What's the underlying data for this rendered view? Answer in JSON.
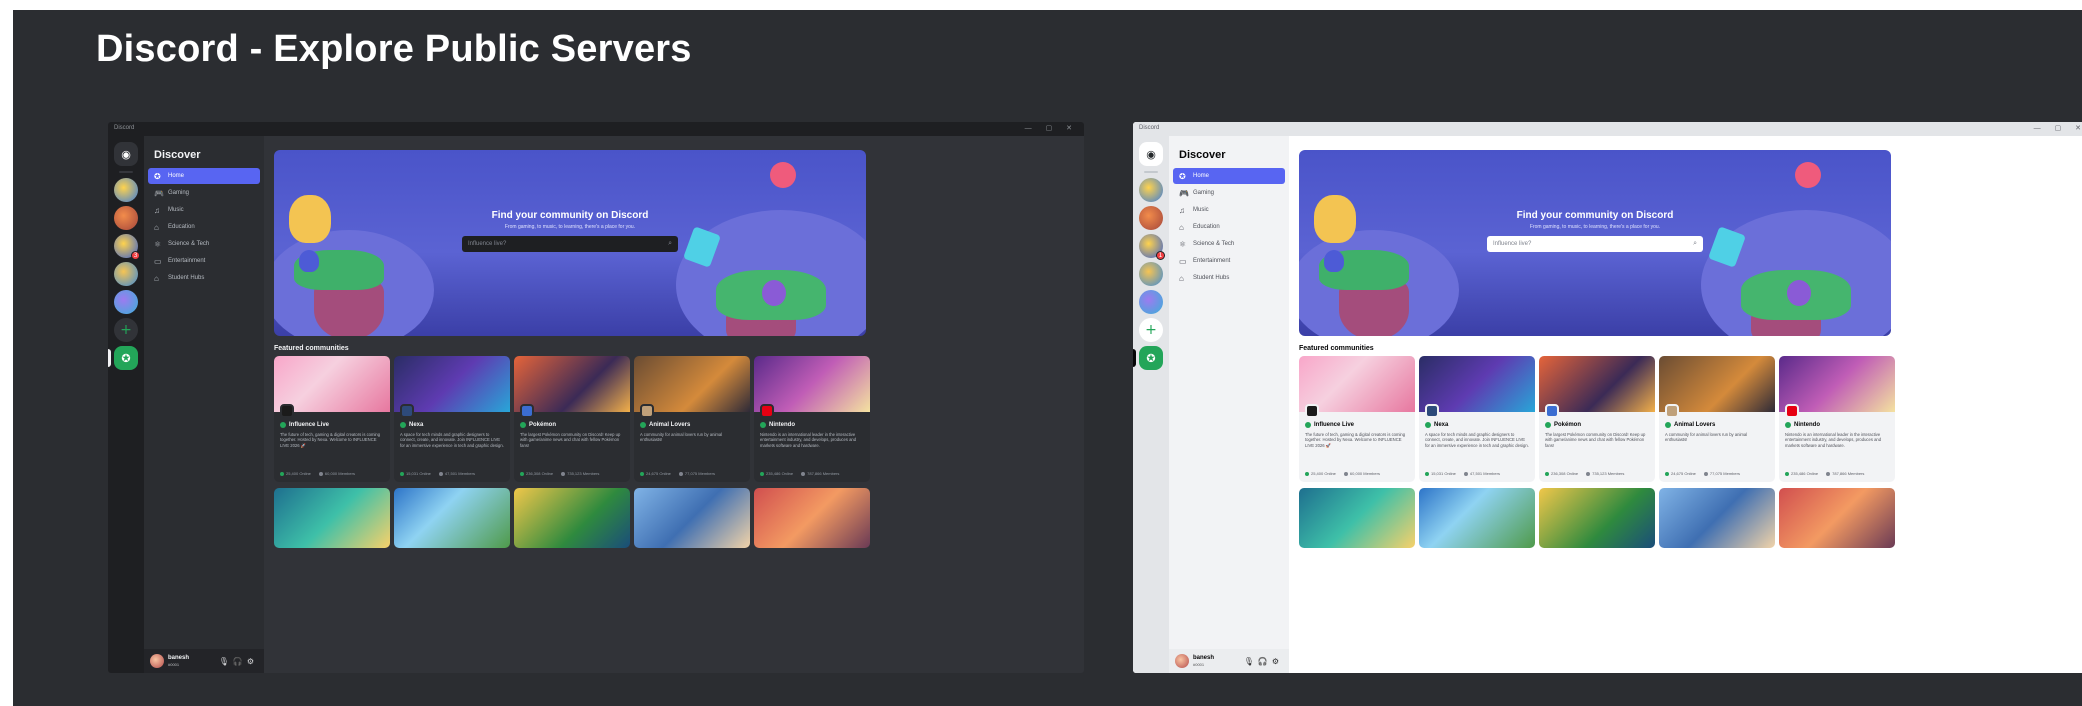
{
  "page_title": "Discord - Explore Public Servers",
  "window": {
    "title": "Discord",
    "controls": "— ▢ ✕"
  },
  "rail": {
    "badges": [
      "3",
      "1"
    ]
  },
  "sidebar": {
    "title": "Discover",
    "items": [
      {
        "label": "Home",
        "icon": "compass-icon"
      },
      {
        "label": "Gaming",
        "icon": "gamepad-icon"
      },
      {
        "label": "Music",
        "icon": "music-note-icon"
      },
      {
        "label": "Education",
        "icon": "graduation-cap-icon"
      },
      {
        "label": "Science & Tech",
        "icon": "atom-icon"
      },
      {
        "label": "Entertainment",
        "icon": "tv-icon"
      },
      {
        "label": "Student Hubs",
        "icon": "school-icon"
      }
    ]
  },
  "user": {
    "name": "banesh",
    "tag": "#0001"
  },
  "hero": {
    "title": "Find your community on Discord",
    "subtitle": "From gaming, to music, to learning, there's a place for you.",
    "search_placeholder": "Influence live?"
  },
  "featured": {
    "title": "Featured communities",
    "cards": [
      {
        "name": "Influence Live",
        "desc": "The future of tech, gaming & digital creators is coming together. Hosted by Nexa. Welcome to INFLUENCE LIVE 2026 🚀",
        "online": "25,400 Online",
        "members": "60,000 Members"
      },
      {
        "name": "Nexa",
        "desc": "A space for tech minds and graphic designers to connect, create, and innovate. Join INFLUENCE LIVE for an immersive experience in tech and graphic design.",
        "online": "15,031 Online",
        "members": "47,501 Members"
      },
      {
        "name": "Pokémon",
        "desc": "The largest Pokémon community on Discord! Keep up with game/anime news and chat with fellow Pokémon fans!",
        "online": "236,308 Online",
        "members": "735,123 Members"
      },
      {
        "name": "Animal Lovers",
        "desc": "A community for animal lovers run by animal enthusiasts!",
        "online": "24,675 Online",
        "members": "77,075 Members"
      },
      {
        "name": "Nintendo",
        "desc": "Nintendo is an international leader in the interactive entertainment industry, and develops, produces and markets software and hardware.",
        "online": "235,486 Online",
        "members": "787,866 Members"
      }
    ]
  },
  "colors": {
    "blurple": "#5865f2",
    "green": "#23a559",
    "dark_bg": "#313338",
    "light_bg": "#ffffff"
  }
}
